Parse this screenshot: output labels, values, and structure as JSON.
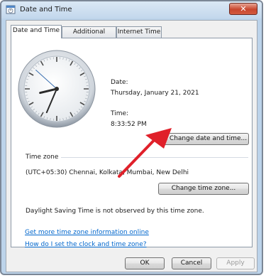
{
  "window": {
    "title": "Date and Time",
    "close_glyph": "✕"
  },
  "tabs": [
    {
      "label": "Date and Time",
      "active": true
    },
    {
      "label": "Additional Clocks",
      "active": false
    },
    {
      "label": "Internet Time",
      "active": false
    }
  ],
  "date_section": {
    "date_label": "Date:",
    "date_value": "Thursday, January 21, 2021",
    "time_label": "Time:",
    "time_value": "8:33:52 PM",
    "change_datetime_button": "Change date and time..."
  },
  "clock": {
    "hour": 8,
    "minute": 33,
    "second": 52
  },
  "timezone_section": {
    "heading": "Time zone",
    "value": "(UTC+05:30) Chennai, Kolkata, Mumbai, New Delhi",
    "change_timezone_button": "Change time zone...",
    "dst_note": "Daylight Saving Time is not observed by this time zone."
  },
  "links": {
    "more_info": "Get more time zone information online",
    "how_to_set": "How do I set the clock and time zone?"
  },
  "footer": {
    "ok": "OK",
    "cancel": "Cancel",
    "apply": "Apply"
  },
  "colors": {
    "annotation_arrow": "#e0202a",
    "link": "#0066cc"
  }
}
